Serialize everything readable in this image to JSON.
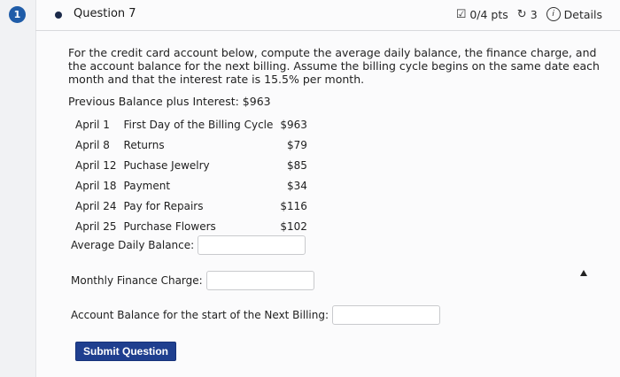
{
  "question": {
    "number_badge": "1",
    "title": "Question 7",
    "points": "0/4 pts",
    "attempts": "3",
    "details_label": "Details"
  },
  "prompt": {
    "text": "For the credit card account below, compute the average daily balance, the finance charge, and the account balance for the next billing. Assume the billing cycle begins on the same date each month and that the interest rate is 15.5% per month.",
    "previous_balance": "Previous Balance plus Interest: $963"
  },
  "transactions": [
    {
      "date": "April 1",
      "description": "First Day of the Billing Cycle",
      "amount": "$963"
    },
    {
      "date": "April 8",
      "description": "Returns",
      "amount": "$79"
    },
    {
      "date": "April 12",
      "description": "Puchase Jewelry",
      "amount": "$85"
    },
    {
      "date": "April 18",
      "description": "Payment",
      "amount": "$34"
    },
    {
      "date": "April 24",
      "description": "Pay for Repairs",
      "amount": "$116"
    },
    {
      "date": "April 25",
      "description": "Purchase Flowers",
      "amount": "$102"
    }
  ],
  "fields": {
    "avg_daily_label": "Average Daily Balance:",
    "finance_label": "Monthly Finance Charge:",
    "next_billing_label": "Account Balance for the start of the Next Billing:"
  },
  "submit_label": "Submit Question",
  "icons": {
    "points": "checkbox-edit-icon",
    "attempts": "retry-icon",
    "details": "info-icon"
  }
}
